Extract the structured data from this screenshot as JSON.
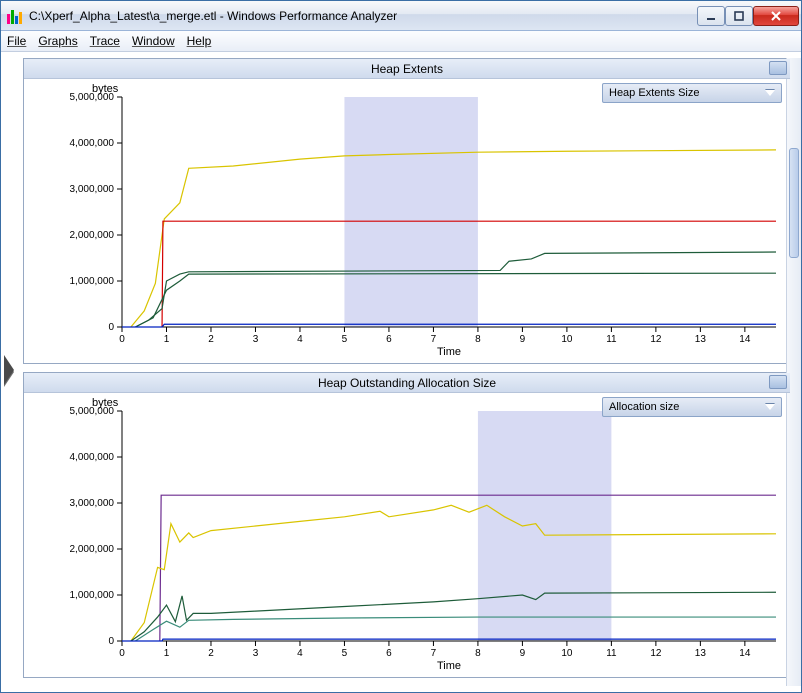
{
  "window": {
    "title": "C:\\Xperf_Alpha_Latest\\a_merge.etl - Windows Performance Analyzer"
  },
  "menu": {
    "file": "File",
    "graphs": "Graphs",
    "trace": "Trace",
    "window": "Window",
    "help": "Help"
  },
  "panel1": {
    "title": "Heap Extents",
    "legend": "Heap Extents Size"
  },
  "panel2": {
    "title": "Heap Outstanding Allocation Size",
    "legend": "Allocation size"
  },
  "axes": {
    "ylabel": "bytes",
    "xlabel": "Time"
  },
  "chart_data": [
    {
      "type": "line",
      "title": "Heap Extents",
      "xlabel": "Time",
      "ylabel": "bytes",
      "xlim": [
        0,
        14.7
      ],
      "ylim": [
        0,
        5000000
      ],
      "yticks": [
        0,
        1000000,
        2000000,
        3000000,
        4000000,
        5000000
      ],
      "ytick_labels": [
        "0",
        "1,000,000",
        "2,000,000",
        "3,000,000",
        "4,000,000",
        "5,000,000"
      ],
      "xticks": [
        0,
        1,
        2,
        3,
        4,
        5,
        6,
        7,
        8,
        9,
        10,
        11,
        12,
        13,
        14
      ],
      "selection": [
        5.0,
        8.0
      ],
      "series": [
        {
          "name": "yellow",
          "color": "#d9c400",
          "values": [
            [
              0.2,
              0
            ],
            [
              0.5,
              350000
            ],
            [
              0.75,
              950000
            ],
            [
              0.95,
              2350000
            ],
            [
              1.3,
              2700000
            ],
            [
              1.5,
              3450000
            ],
            [
              2.5,
              3500000
            ],
            [
              4,
              3650000
            ],
            [
              5,
              3720000
            ],
            [
              6,
              3750000
            ],
            [
              8,
              3800000
            ],
            [
              10,
              3820000
            ],
            [
              14.7,
              3850000
            ]
          ]
        },
        {
          "name": "red",
          "color": "#d40000",
          "values": [
            [
              0.9,
              0
            ],
            [
              0.92,
              2300000
            ],
            [
              14.7,
              2300000
            ]
          ]
        },
        {
          "name": "darkgreen-upper",
          "color": "#1e5c3a",
          "values": [
            [
              0.3,
              0
            ],
            [
              0.6,
              150000
            ],
            [
              0.9,
              400000
            ],
            [
              1.0,
              1000000
            ],
            [
              1.3,
              1150000
            ],
            [
              1.5,
              1200000
            ],
            [
              8.5,
              1230000
            ],
            [
              8.7,
              1430000
            ],
            [
              9.2,
              1480000
            ],
            [
              9.5,
              1600000
            ],
            [
              14.7,
              1630000
            ]
          ]
        },
        {
          "name": "darkgreen-lower",
          "color": "#1e5c3a",
          "values": [
            [
              0.3,
              0
            ],
            [
              0.7,
              200000
            ],
            [
              1.0,
              800000
            ],
            [
              1.3,
              1000000
            ],
            [
              1.5,
              1150000
            ],
            [
              14.7,
              1170000
            ]
          ]
        },
        {
          "name": "blue",
          "color": "#0020c0",
          "values": [
            [
              0,
              0
            ],
            [
              0.9,
              0
            ],
            [
              0.95,
              60000
            ],
            [
              14.7,
              60000
            ]
          ]
        }
      ]
    },
    {
      "type": "line",
      "title": "Heap Outstanding Allocation Size",
      "xlabel": "Time",
      "ylabel": "bytes",
      "xlim": [
        0,
        14.7
      ],
      "ylim": [
        0,
        5000000
      ],
      "yticks": [
        0,
        1000000,
        2000000,
        3000000,
        4000000,
        5000000
      ],
      "ytick_labels": [
        "0",
        "1,000,000",
        "2,000,000",
        "3,000,000",
        "4,000,000",
        "5,000,000"
      ],
      "xticks": [
        0,
        1,
        2,
        3,
        4,
        5,
        6,
        7,
        8,
        9,
        10,
        11,
        12,
        13,
        14
      ],
      "selection": [
        8.0,
        11.0
      ],
      "series": [
        {
          "name": "purple",
          "color": "#6c2b8f",
          "values": [
            [
              0.85,
              0
            ],
            [
              0.88,
              3170000
            ],
            [
              14.7,
              3170000
            ]
          ]
        },
        {
          "name": "yellow",
          "color": "#d9c400",
          "values": [
            [
              0.2,
              0
            ],
            [
              0.5,
              400000
            ],
            [
              0.8,
              1600000
            ],
            [
              0.95,
              1550000
            ],
            [
              1.1,
              2550000
            ],
            [
              1.3,
              2150000
            ],
            [
              1.5,
              2350000
            ],
            [
              1.6,
              2250000
            ],
            [
              2,
              2400000
            ],
            [
              3,
              2500000
            ],
            [
              4,
              2600000
            ],
            [
              5,
              2700000
            ],
            [
              5.8,
              2820000
            ],
            [
              6,
              2700000
            ],
            [
              7,
              2850000
            ],
            [
              7.4,
              2950000
            ],
            [
              7.8,
              2800000
            ],
            [
              8.2,
              2950000
            ],
            [
              8.6,
              2700000
            ],
            [
              9,
              2500000
            ],
            [
              9.3,
              2550000
            ],
            [
              9.5,
              2300000
            ],
            [
              14.7,
              2330000
            ]
          ]
        },
        {
          "name": "darkgreen",
          "color": "#1e5c3a",
          "values": [
            [
              0.2,
              0
            ],
            [
              0.5,
              200000
            ],
            [
              0.8,
              520000
            ],
            [
              1.0,
              780000
            ],
            [
              1.2,
              420000
            ],
            [
              1.35,
              980000
            ],
            [
              1.45,
              450000
            ],
            [
              1.6,
              600000
            ],
            [
              2,
              600000
            ],
            [
              3,
              650000
            ],
            [
              5,
              750000
            ],
            [
              7,
              850000
            ],
            [
              8,
              920000
            ],
            [
              9,
              1000000
            ],
            [
              9.3,
              900000
            ],
            [
              9.5,
              1040000
            ],
            [
              14.7,
              1060000
            ]
          ]
        },
        {
          "name": "teal",
          "color": "#3a8c7a",
          "values": [
            [
              0.3,
              0
            ],
            [
              0.7,
              250000
            ],
            [
              1.0,
              430000
            ],
            [
              1.3,
              300000
            ],
            [
              1.5,
              450000
            ],
            [
              2.5,
              470000
            ],
            [
              5,
              500000
            ],
            [
              8,
              520000
            ],
            [
              14.7,
              520000
            ]
          ]
        },
        {
          "name": "blue",
          "color": "#0020c0",
          "values": [
            [
              0,
              0
            ],
            [
              0.9,
              0
            ],
            [
              0.92,
              40000
            ],
            [
              14.7,
              40000
            ]
          ]
        }
      ]
    }
  ]
}
